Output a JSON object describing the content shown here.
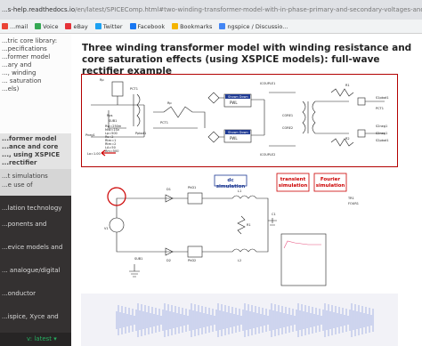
{
  "browser": {
    "url_prefix": "...s-help.readthedocs.io",
    "url_rest": "/en/latest/SPICEComp.html#two-winding-transformer-model-with-in-phase-primary-and-secondary-voltages-and-winding-resistance"
  },
  "bookmarks": [
    {
      "label": "...mail",
      "color": "#ea4335"
    },
    {
      "label": "Voice",
      "color": "#34a853"
    },
    {
      "label": "eBay",
      "color": "#e53238"
    },
    {
      "label": "Twitter",
      "color": "#1da1f2"
    },
    {
      "label": "Facebook",
      "color": "#1877f2"
    },
    {
      "label": "Bookmarks",
      "color": "#f4b400"
    },
    {
      "label": "ngspice / Discussio...",
      "color": "#4285f4"
    }
  ],
  "sidebar": {
    "items_light": [
      {
        "label": "...tric core library:",
        "bold": false
      },
      {
        "label": "...pecifications",
        "bold": false
      },
      {
        "label": "...former model",
        "bold": false
      },
      {
        "label": "...ary and",
        "bold": false
      },
      {
        "label": "..., winding",
        "bold": false
      },
      {
        "label": "... saturation",
        "bold": false
      },
      {
        "label": "...els)",
        "bold": false
      }
    ],
    "items_selected": [
      "...former model",
      "...ance and core",
      "..., using XSPICE",
      "...rectifier"
    ],
    "items_gray": [
      "...t simulations",
      "...e use of"
    ],
    "items_dark": [
      "...lation technology",
      "...ponents and",
      "...evice models and",
      "... analogue/digital",
      "...onductor",
      "...ispice, Xyce and",
      "... simulation and",
      "...action interface"
    ],
    "version": "v: latest ▾"
  },
  "main": {
    "title": "Three winding transformer model with winding resistance and core saturation effects (using XSPICE models): full-wave rectifier example"
  },
  "schematic1": {
    "labels": [
      "Rp",
      "PCT1",
      "Rps",
      "Pneg1",
      "Rp",
      "PCT1",
      "Ppbot1",
      "S2neg1",
      "SUB1",
      "Rw=250m",
      "MW=1Sn",
      "Lp=500",
      "Rs=2",
      "Rtm=1",
      "Rtm=2",
      "LA=50",
      "Rm=500",
      "Shown Down",
      "PWL",
      "Shown Down",
      "PWL",
      "ICOUPLE1",
      "ICOUPLE2",
      "CORE1",
      "CORE2",
      "R1",
      "R2",
      "PCT1",
      "S2neg1",
      "S1pbot1",
      "S2pbot1"
    ],
    "lo_label": "Lo=1.00"
  },
  "schematic2": {
    "blue_boxes": [
      "dc simulation",
      "transient simulation",
      "Fourier simulation"
    ],
    "labels": [
      "D1",
      "D2",
      "PhD1",
      "PhD2",
      "L1",
      "L2",
      "C1",
      "R1",
      "V1",
      "SUB1",
      "TR1",
      "FOUR1"
    ]
  }
}
